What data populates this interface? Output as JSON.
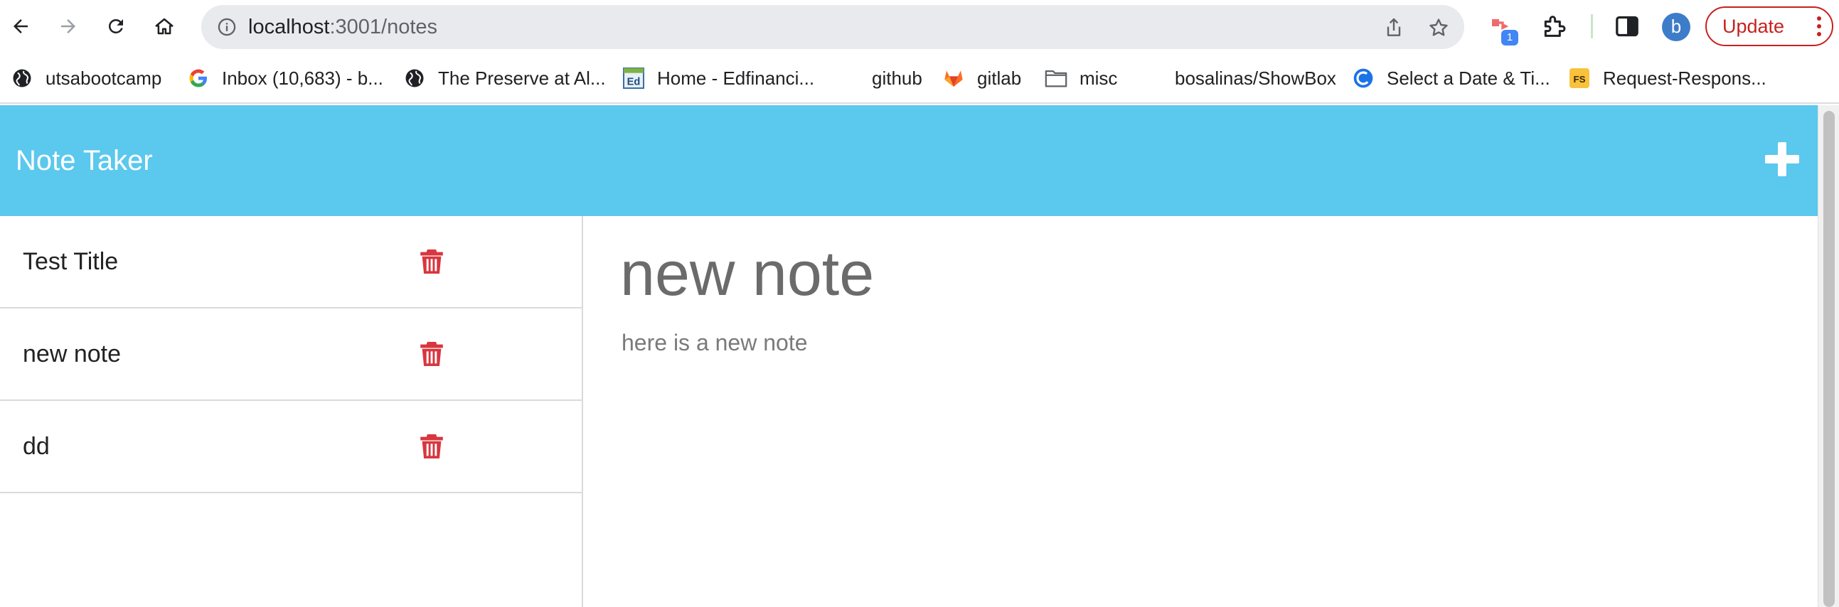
{
  "browser": {
    "url_host": "localhost",
    "url_rest": ":3001/notes",
    "update_label": "Update",
    "profile_initial": "b",
    "extension_badge": "1",
    "bookmarks": [
      {
        "label": "utsabootcamp",
        "icon": "globe-icon"
      },
      {
        "label": "Inbox (10,683) - b...",
        "icon": "google-icon"
      },
      {
        "label": "The Preserve at Al...",
        "icon": "globe-icon"
      },
      {
        "label": "Home - Edfinanci...",
        "icon": "ed-icon"
      },
      {
        "label": "github",
        "icon": "none"
      },
      {
        "label": "gitlab",
        "icon": "gitlab-icon"
      },
      {
        "label": "misc",
        "icon": "folder-icon"
      },
      {
        "label": "bosalinas/ShowBox",
        "icon": "none"
      },
      {
        "label": "Select a Date & Ti...",
        "icon": "calendly-icon"
      },
      {
        "label": "Request-Respons...",
        "icon": "fs-icon"
      }
    ]
  },
  "app": {
    "title": "Note Taker",
    "header_color": "#5bc8ed",
    "delete_color": "#d9363e"
  },
  "notes": [
    {
      "title": "Test Title"
    },
    {
      "title": "new note"
    },
    {
      "title": "dd"
    }
  ],
  "active_note": {
    "title": "new note",
    "text": "here is a new note"
  }
}
